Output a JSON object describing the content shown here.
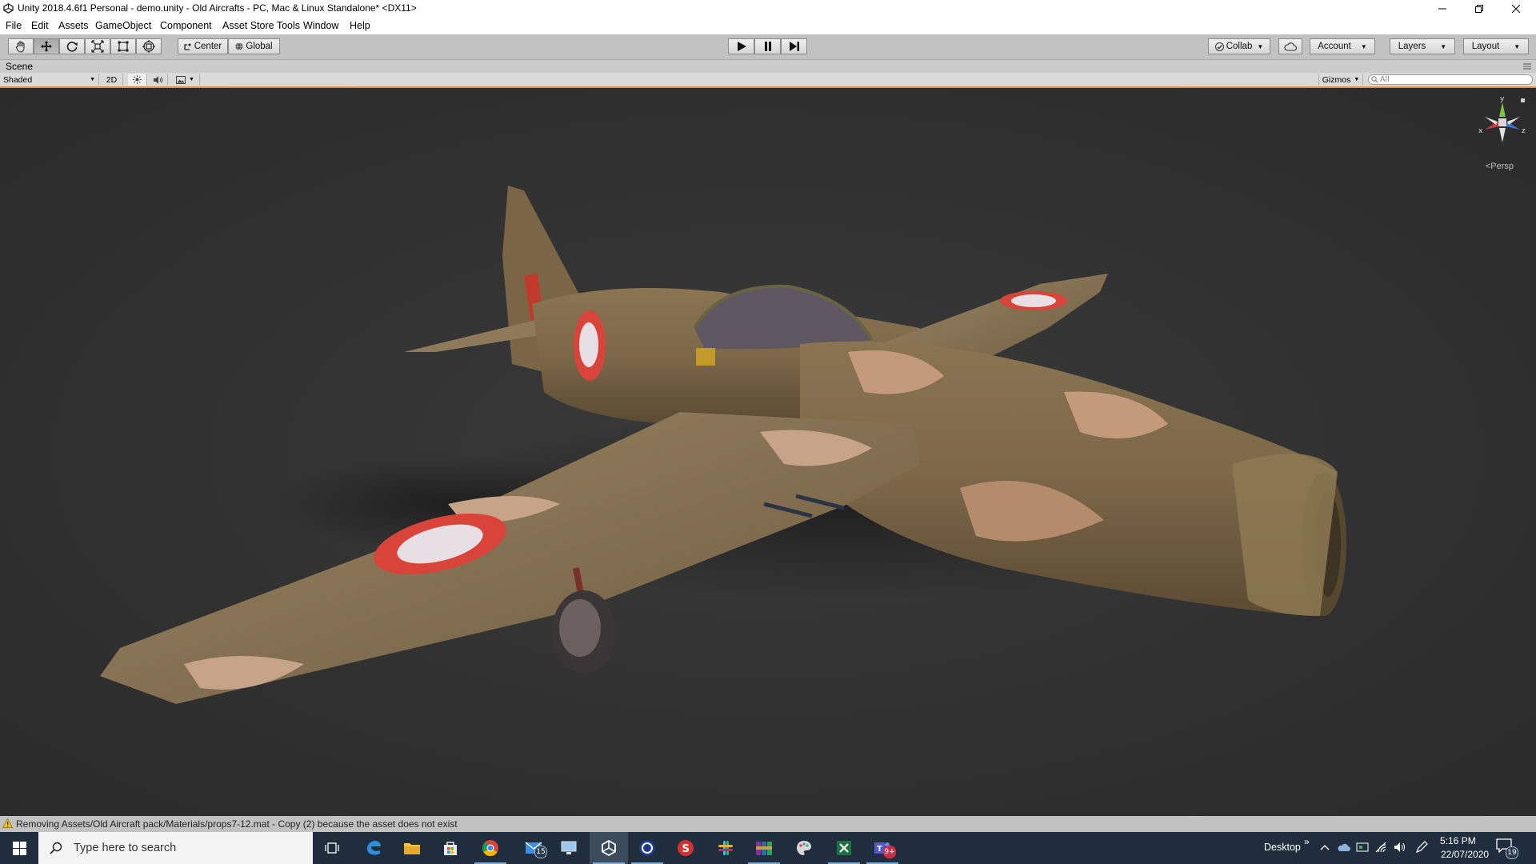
{
  "window": {
    "title": "Unity 2018.4.6f1 Personal - demo.unity - Old Aircrafts - PC, Mac & Linux Standalone* <DX11>"
  },
  "menu": [
    "File",
    "Edit",
    "Assets",
    "GameObject",
    "Component",
    "Asset Store Tools",
    "Window",
    "Help"
  ],
  "toolbar": {
    "pivot_label": "Center",
    "space_label": "Global",
    "collab_label": "Collab",
    "account_label": "Account",
    "layers_label": "Layers",
    "layout_label": "Layout"
  },
  "scene": {
    "tab_label": "Scene",
    "shading_mode": "Shaded",
    "mode_2d": "2D",
    "gizmos_label": "Gizmos",
    "search_placeholder": "All",
    "projection_label": "Persp",
    "axis_labels": {
      "x": "x",
      "y": "y",
      "z": "z"
    }
  },
  "status": {
    "message": "Removing Assets/Old Aircraft pack/Materials/props7-12.mat - Copy (2) because the asset does not exist"
  },
  "taskbar": {
    "search_placeholder": "Type here to search",
    "mail_badge": "15",
    "teams_badge": "9+",
    "desktop_label": "Desktop",
    "time": "5:16 PM",
    "date": "22/07/2020",
    "notifications_count": "19"
  },
  "colors": {
    "scene_bg": "#303030",
    "accent_orange": "#ea8a3b",
    "taskbar_bg": "#1f2d3d"
  }
}
